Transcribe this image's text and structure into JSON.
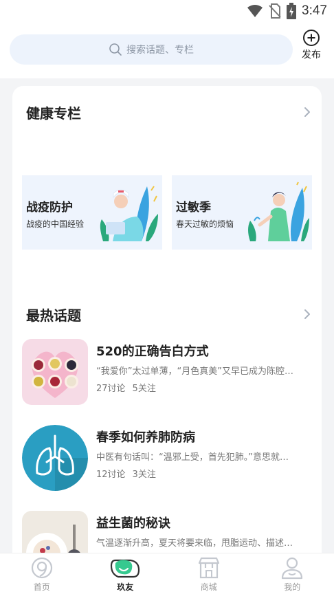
{
  "status_bar": {
    "time": "3:47"
  },
  "search": {
    "placeholder": "搜索话题、专栏"
  },
  "publish": {
    "label": "发布"
  },
  "columns": {
    "title": "健康专栏",
    "items": [
      {
        "title": "战疫防护",
        "subtitle": "战疫的中国经验"
      },
      {
        "title": "过敏季",
        "subtitle": "春天过敏的烦恼"
      }
    ]
  },
  "topics": {
    "title": "最热话题",
    "items": [
      {
        "title": "520的正确告白方式",
        "desc": "“我爱你”太过单薄，“月色真美”又早已成为陈腔…",
        "discuss": "27讨论",
        "follow": "5关注"
      },
      {
        "title": "春季如何养肺防病",
        "desc": "中医有句话叫：“温邪上受，首先犯肺。”意思就…",
        "discuss": "12讨论",
        "follow": "3关注"
      },
      {
        "title": "益生菌的秘诀",
        "desc": "气温逐渐升高，夏天将要来临，甩脂运动、描述…",
        "discuss": "",
        "follow": ""
      }
    ]
  },
  "tabs": [
    {
      "label": "首页"
    },
    {
      "label": "玖友"
    },
    {
      "label": "商城"
    },
    {
      "label": "我的"
    }
  ],
  "colors": {
    "accent_green": "#36c98f",
    "banner_bg": "#eef4fd",
    "search_bg": "#edf3fc",
    "lung_bg": "#2a9ec2"
  }
}
